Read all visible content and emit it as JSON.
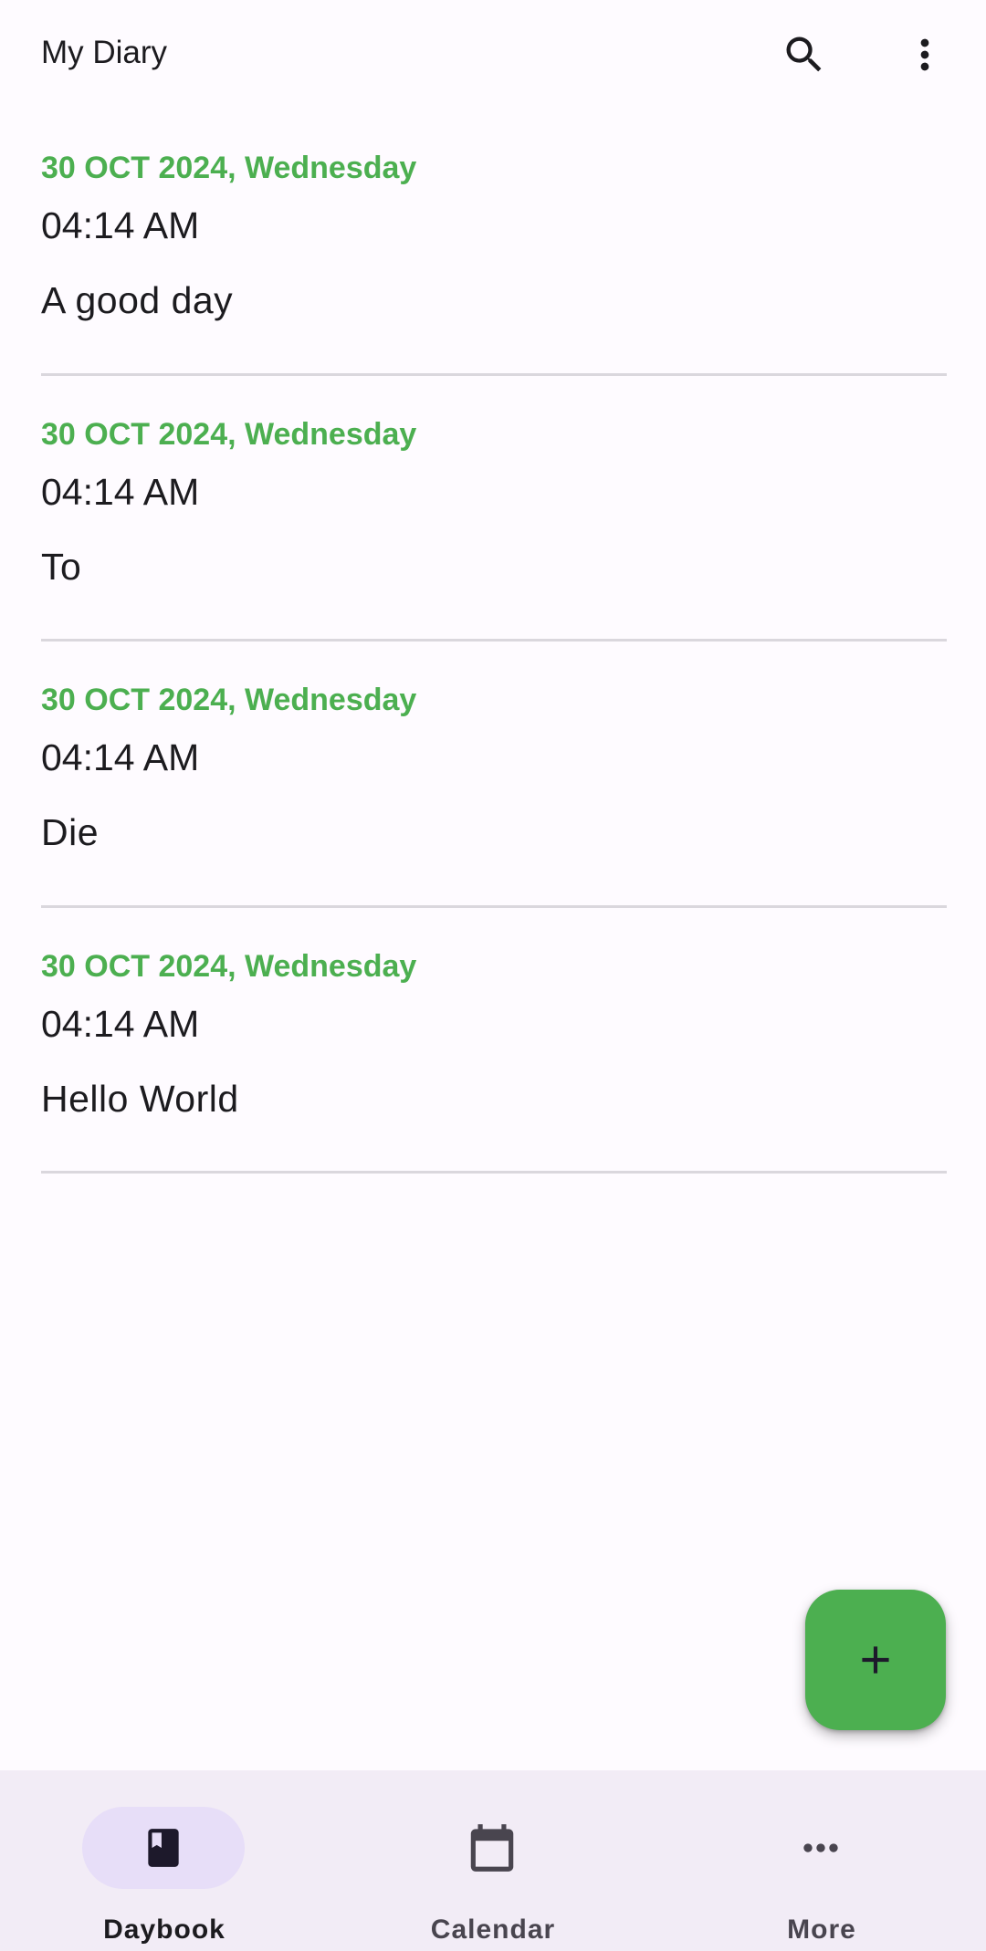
{
  "app_bar": {
    "title": "My Diary",
    "search_icon": "search-icon",
    "overflow_icon": "more-vert-icon"
  },
  "entries": [
    {
      "date": "30 OCT 2024, Wednesday",
      "time": "04:14 AM",
      "text": "A good day"
    },
    {
      "date": "30 OCT 2024, Wednesday",
      "time": "04:14 AM",
      "text": "To"
    },
    {
      "date": "30 OCT 2024, Wednesday",
      "time": "04:14 AM",
      "text": "Die"
    },
    {
      "date": "30 OCT 2024, Wednesday",
      "time": "04:14 AM",
      "text": "Hello World"
    }
  ],
  "fab": {
    "icon": "plus-icon"
  },
  "bottom_nav": {
    "items": [
      {
        "label": "Daybook",
        "icon": "book-icon",
        "active": true
      },
      {
        "label": "Calendar",
        "icon": "calendar-icon",
        "active": false
      },
      {
        "label": "More",
        "icon": "more-horiz-icon",
        "active": false
      }
    ]
  },
  "colors": {
    "accent": "#4caf50",
    "nav_background": "#f2ecf6",
    "nav_active_pill": "#e7def8",
    "divider": "#dad7dd"
  }
}
